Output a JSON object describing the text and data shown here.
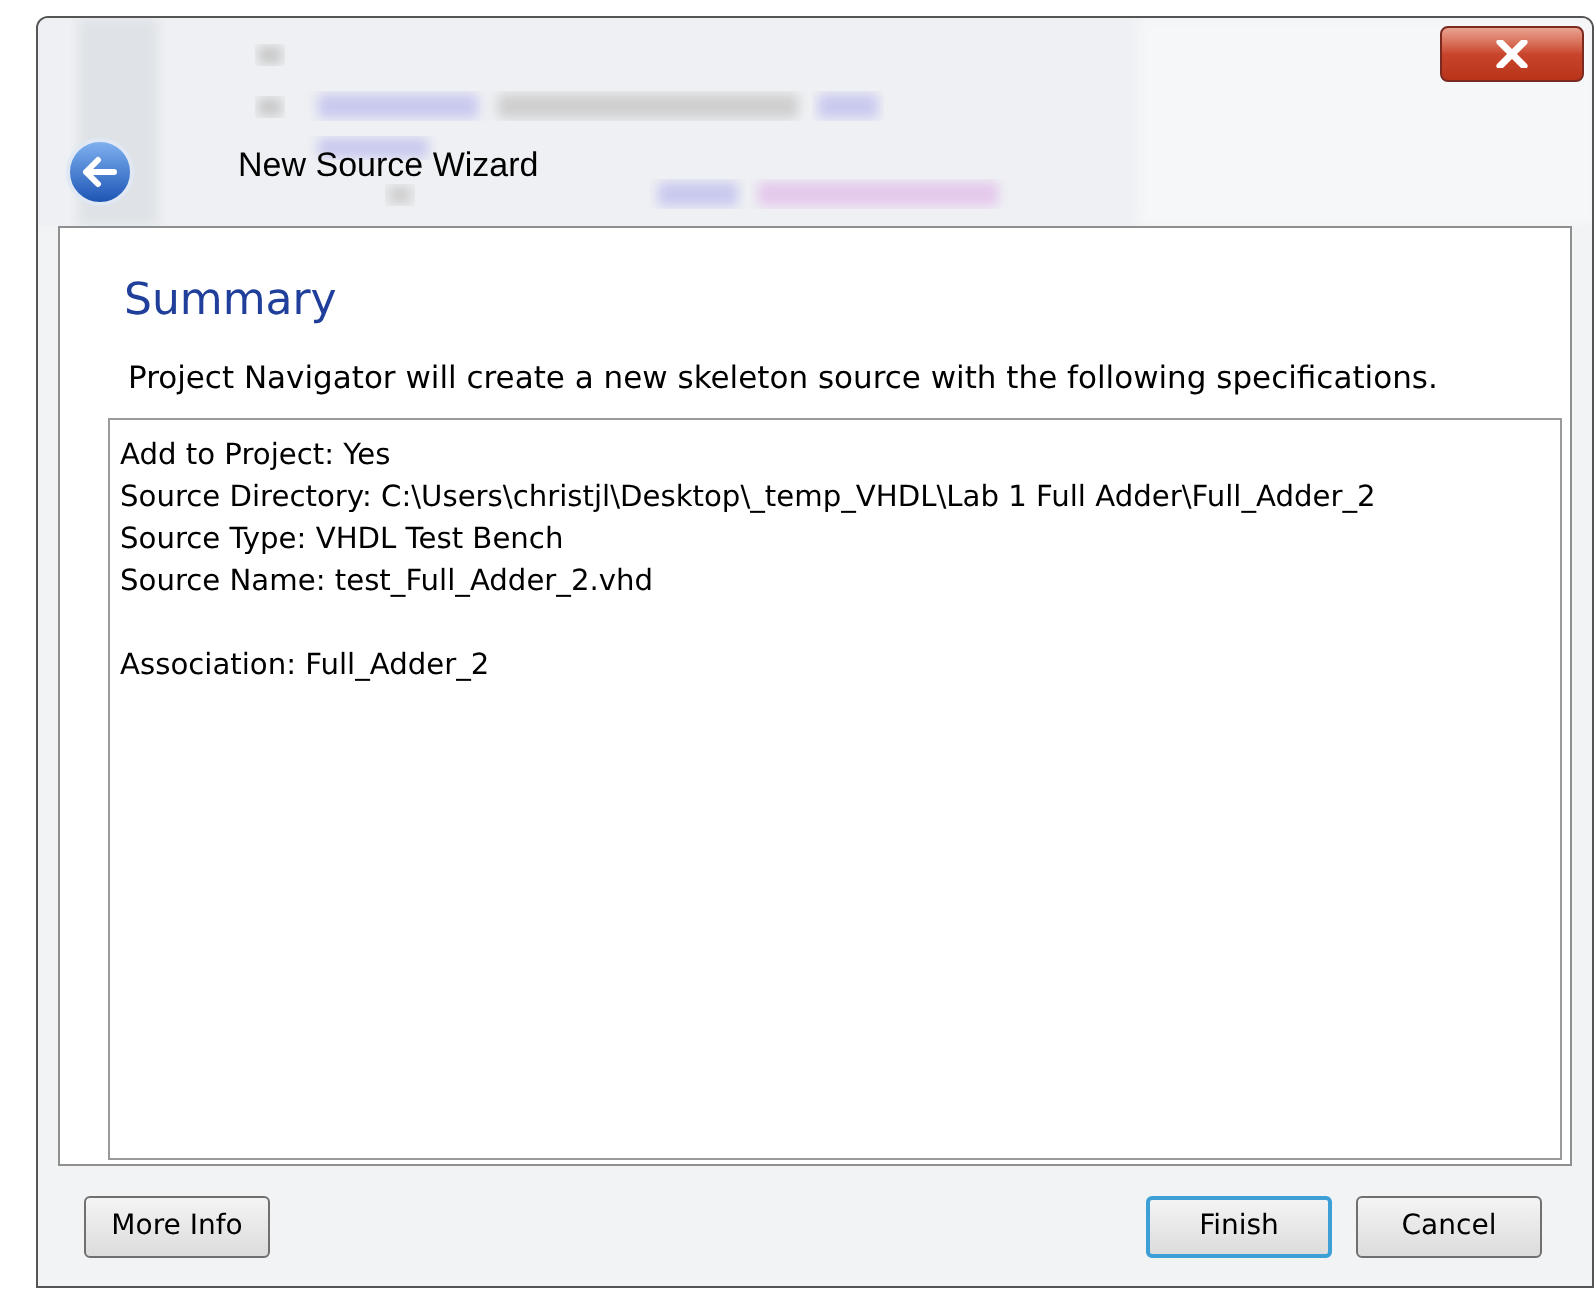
{
  "window": {
    "title": "New Source Wizard"
  },
  "page": {
    "heading": "Summary",
    "description": "Project Navigator will create a new skeleton source with the following specifications.",
    "details": [
      [
        "Add to Project: Yes",
        "Source Directory: C:\\Users\\christjl\\Desktop\\_temp_VHDL\\Lab 1 Full Adder\\Full_Adder_2",
        "Source Type: VHDL Test Bench",
        "Source Name: test_Full_Adder_2.vhd"
      ],
      [
        "Association: Full_Adder_2"
      ]
    ]
  },
  "buttons_left": [
    {
      "label": "More Info",
      "default": false
    }
  ],
  "buttons_right": [
    {
      "label": "Finish",
      "default": true
    },
    {
      "label": "Cancel",
      "default": false
    }
  ]
}
